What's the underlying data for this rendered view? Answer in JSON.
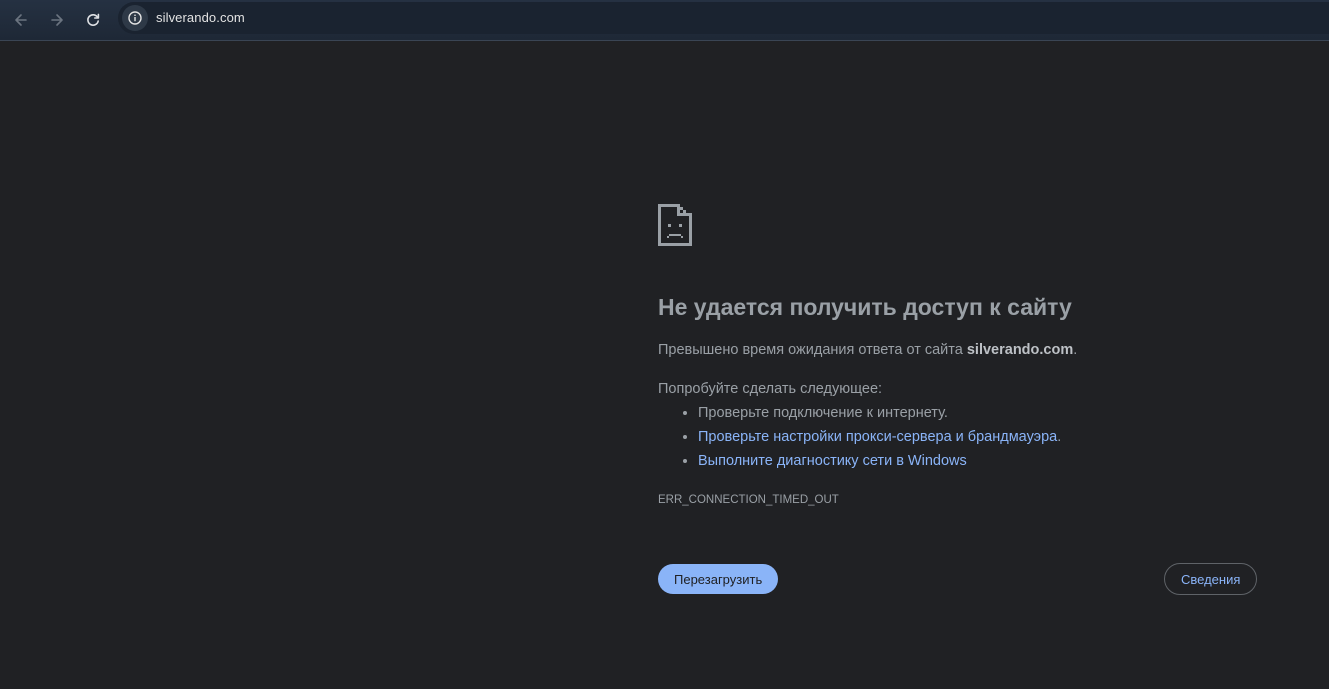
{
  "toolbar": {
    "back_icon": "arrow-left-icon",
    "forward_icon": "arrow-right-icon",
    "reload_icon": "reload-icon",
    "site_info_icon": "info-icon",
    "url": "silverando.com"
  },
  "error_page": {
    "icon": "sad-page-icon",
    "heading": "Не удается получить доступ к сайту",
    "summary_prefix": "Превышено время ожидания ответа от сайта ",
    "summary_host": "silverando.com",
    "summary_suffix": ".",
    "suggestions_title": "Попробуйте сделать следующее:",
    "suggestions": [
      {
        "text": "Проверьте подключение к интернету.",
        "link": "",
        "suffix": ""
      },
      {
        "text": "",
        "link": "Проверьте настройки прокси-сервера и брандмауэра",
        "suffix": "."
      },
      {
        "text": "",
        "link": "Выполните диагностику сети в Windows",
        "suffix": ""
      }
    ],
    "error_code": "ERR_CONNECTION_TIMED_OUT",
    "reload_label": "Перезагрузить",
    "details_label": "Сведения"
  },
  "colors": {
    "page_background": "#202124",
    "text": "#9aa0a6",
    "link": "#8ab4f8",
    "primary_button": "#8ab4f8"
  }
}
